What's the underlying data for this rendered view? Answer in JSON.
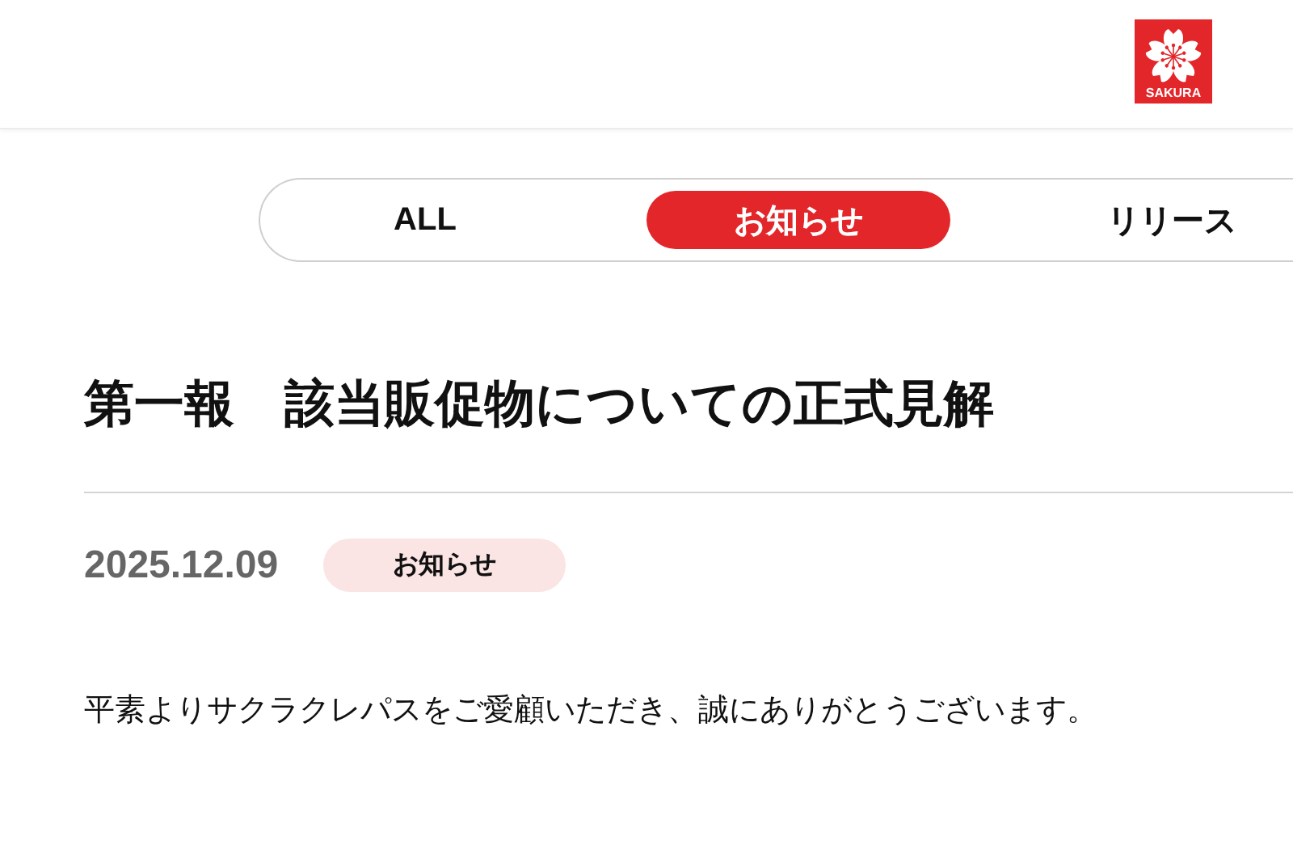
{
  "header": {
    "logo": {
      "text": "SAKURA"
    }
  },
  "tabs": [
    {
      "label": "ALL",
      "selected": false
    },
    {
      "label": "お知らせ",
      "selected": true
    },
    {
      "label": "リリース",
      "selected": false
    }
  ],
  "article": {
    "title": "第一報　該当販促物についての正式見解",
    "date": "2025.12.09",
    "category": "お知らせ",
    "body": "平素よりサクラクレパスをご愛顧いただき、誠にありがとうございます。"
  }
}
